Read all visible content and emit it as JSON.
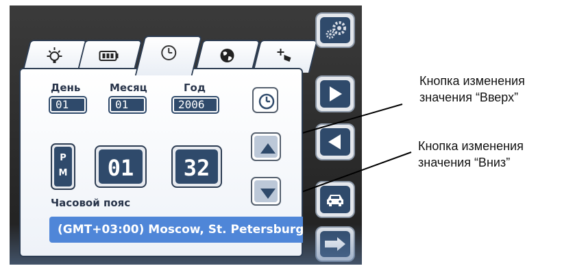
{
  "tabs": [
    {
      "icon": "brightness-icon",
      "glyph": "☼"
    },
    {
      "icon": "battery-icon",
      "glyph": "▮▮▮"
    },
    {
      "icon": "clock-icon",
      "glyph": "◷"
    },
    {
      "icon": "globe-icon",
      "glyph": "◍"
    },
    {
      "icon": "touch-calibration-icon",
      "glyph": "✥"
    }
  ],
  "date": {
    "day_label": "День",
    "day_value": "01",
    "month_label": "Месяц",
    "month_value": "01",
    "year_label": "Год",
    "year_value": "2006"
  },
  "time": {
    "ampm_top": "P",
    "ampm_bottom": "M",
    "hours": "01",
    "minutes": "32"
  },
  "timezone": {
    "label": "Часовой пояс",
    "value": "(GMT+03:00) Moscow, St. Petersburg"
  },
  "toolbar": {
    "icons": [
      "settings-gear-icon",
      "next-arrow-icon",
      "previous-arrow-icon",
      "car-icon",
      "exit-arrow-icon"
    ]
  },
  "callouts": {
    "up_line1": "Кнопка изменения",
    "up_line2": "значения “Вверх”",
    "down_line1": "Кнопка изменения",
    "down_line2": "значения “Вниз”"
  },
  "colors": {
    "field_bg": "#2f4a6b",
    "timezone_bg": "#4f86d8",
    "frame": "#2c3c52"
  }
}
